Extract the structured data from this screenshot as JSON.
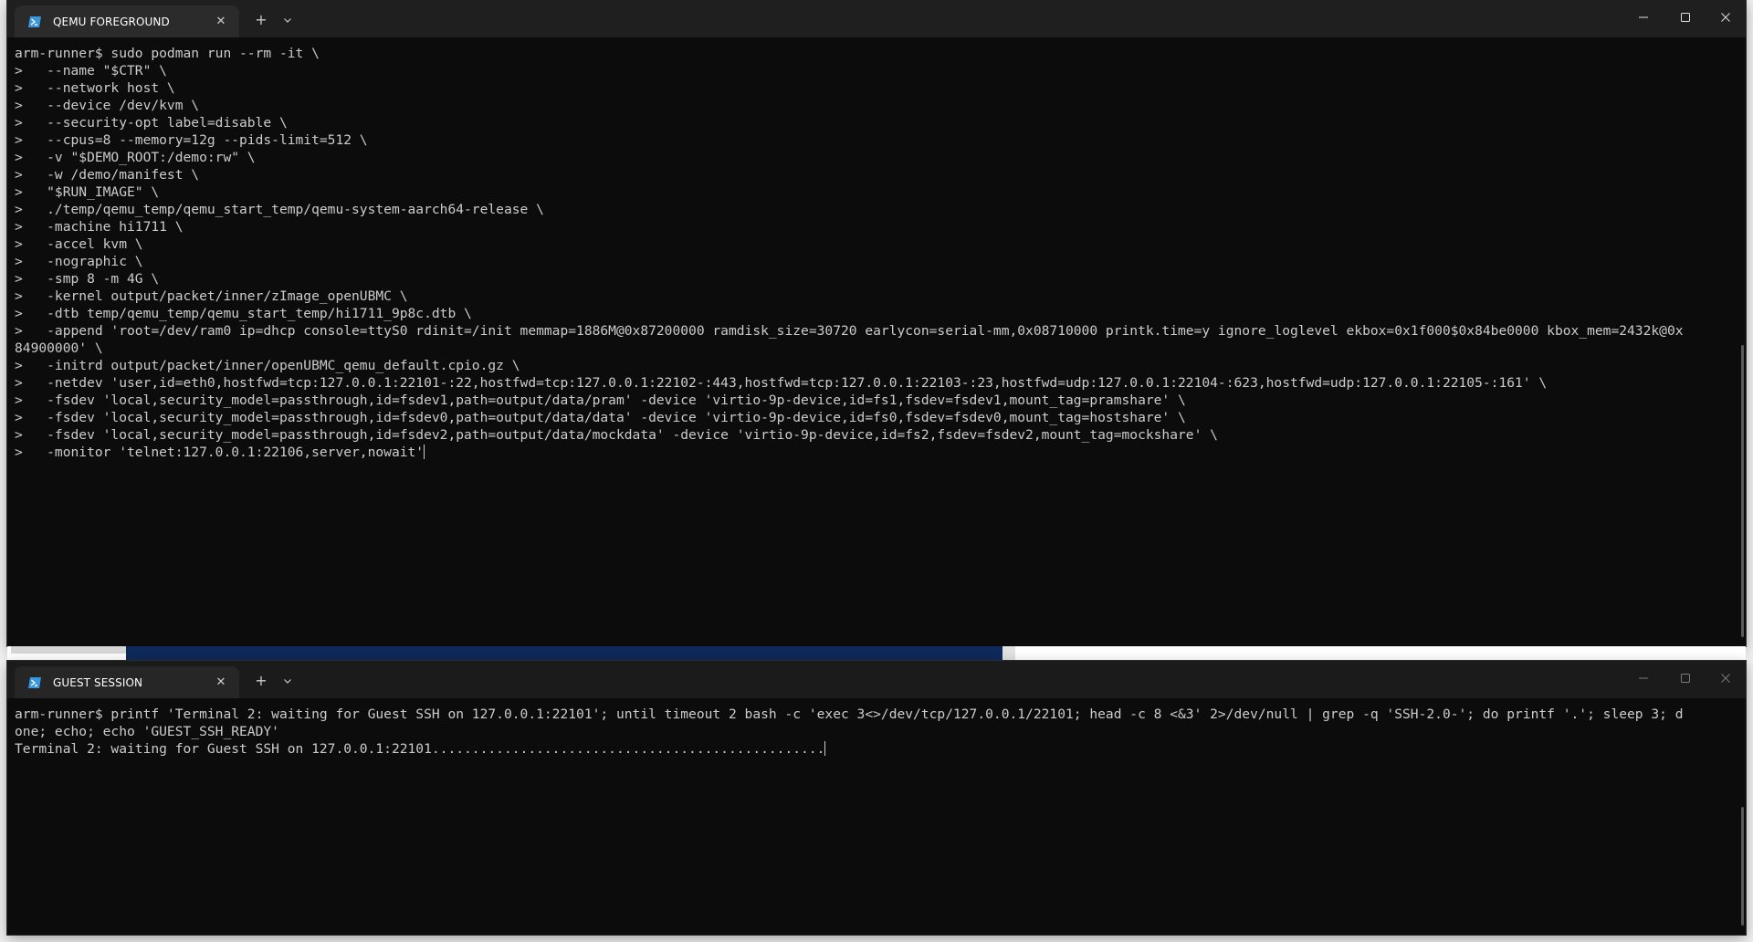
{
  "terminal_top": {
    "tab_title": "QEMU FOREGROUND",
    "lines": [
      "arm-runner$ sudo podman run --rm -it \\",
      ">   --name \"$CTR\" \\",
      ">   --network host \\",
      ">   --device /dev/kvm \\",
      ">   --security-opt label=disable \\",
      ">   --cpus=8 --memory=12g --pids-limit=512 \\",
      ">   -v \"$DEMO_ROOT:/demo:rw\" \\",
      ">   -w /demo/manifest \\",
      ">   \"$RUN_IMAGE\" \\",
      ">   ./temp/qemu_temp/qemu_start_temp/qemu-system-aarch64-release \\",
      ">   -machine hi1711 \\",
      ">   -accel kvm \\",
      ">   -nographic \\",
      ">   -smp 8 -m 4G \\",
      ">   -kernel output/packet/inner/zImage_openUBMC \\",
      ">   -dtb temp/qemu_temp/qemu_start_temp/hi1711_9p8c.dtb \\",
      ">   -append 'root=/dev/ram0 ip=dhcp console=ttyS0 rdinit=/init memmap=1886M@0x87200000 ramdisk_size=30720 earlycon=serial-mm,0x08710000 printk.time=y ignore_loglevel ekbox=0x1f000$0x84be0000 kbox_mem=2432k@0x",
      "84900000' \\",
      ">   -initrd output/packet/inner/openUBMC_qemu_default.cpio.gz \\",
      ">   -netdev 'user,id=eth0,hostfwd=tcp:127.0.0.1:22101-:22,hostfwd=tcp:127.0.0.1:22102-:443,hostfwd=tcp:127.0.0.1:22103-:23,hostfwd=udp:127.0.0.1:22104-:623,hostfwd=udp:127.0.0.1:22105-:161' \\",
      ">   -fsdev 'local,security_model=passthrough,id=fsdev1,path=output/data/pram' -device 'virtio-9p-device,id=fs1,fsdev=fsdev1,mount_tag=pramshare' \\",
      ">   -fsdev 'local,security_model=passthrough,id=fsdev0,path=output/data/data' -device 'virtio-9p-device,id=fs0,fsdev=fsdev0,mount_tag=hostshare' \\",
      ">   -fsdev 'local,security_model=passthrough,id=fsdev2,path=output/data/mockdata' -device 'virtio-9p-device,id=fs2,fsdev=fsdev2,mount_tag=mockshare' \\",
      ">   -monitor 'telnet:127.0.0.1:22106,server,nowait'"
    ]
  },
  "terminal_bottom": {
    "tab_title": "GUEST SESSION",
    "lines": [
      "arm-runner$ printf 'Terminal 2: waiting for Guest SSH on 127.0.0.1:22101'; until timeout 2 bash -c 'exec 3<>/dev/tcp/127.0.0.1/22101; head -c 8 <&3' 2>/dev/null | grep -q 'SSH-2.0-'; do printf '.'; sleep 3; d",
      "one; echo; echo 'GUEST_SSH_READY'",
      "Terminal 2: waiting for Guest SSH on 127.0.0.1:22101................................................."
    ]
  },
  "tab_actions": {
    "new_tab": "+",
    "close_tab": "✕"
  },
  "icons": {
    "tab_icon": "powershell-icon",
    "new_tab": "plus-icon",
    "dropdown": "chevron-down-icon",
    "minimize": "minimize-icon",
    "maximize": "maximize-icon",
    "close": "close-icon"
  },
  "colors": {
    "terminal_bg": "#0c0c0c",
    "terminal_fg": "#cccccc",
    "titlebar_bg": "#1f1f1f",
    "tab_bg": "#2b2b2b",
    "tab_icon": "#3a96dd"
  }
}
